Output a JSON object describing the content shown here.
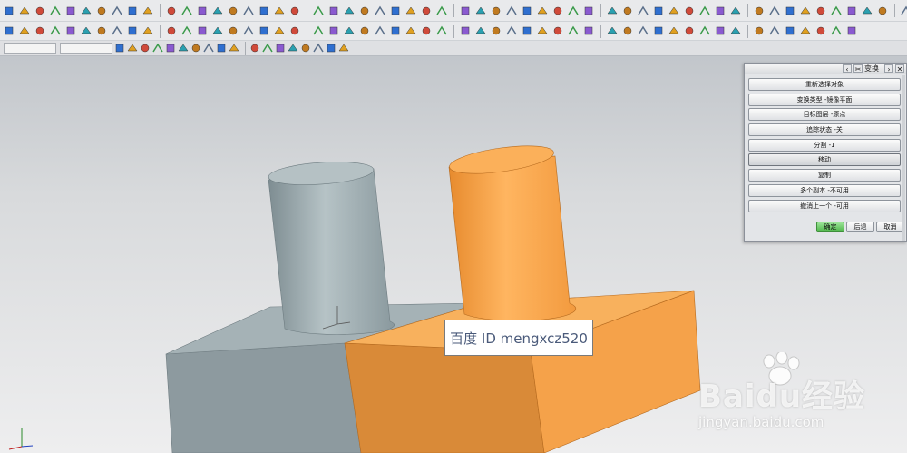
{
  "window": {
    "dialog_title_icon": "scissors-icon",
    "dialog_title": "变换"
  },
  "toolbar": {
    "row1_icons": [
      "grid-icon",
      "edit-icon",
      "copy-icon",
      "tools-icon",
      "vertex-icon",
      "line-icon",
      "curve-icon",
      "wave-icon",
      "spline-icon",
      "pointer-icon",
      "fillet-icon",
      "square-icon",
      "sketch-icon",
      "sphere-icon",
      "cube-icon",
      "block-icon",
      "cylinder-icon",
      "cone-icon",
      "hole-icon",
      "boss-icon",
      "pocket-icon",
      "pad-icon",
      "slot-icon",
      "groove-icon",
      "extrude-icon",
      "revolve-icon",
      "sweep-icon",
      "tube-icon",
      "chamfer-icon",
      "blend-icon",
      "shell-icon",
      "draft-icon",
      "offset-icon",
      "trim-icon",
      "split-icon",
      "sew-icon",
      "patch-icon",
      "unite-icon",
      "subtract-icon",
      "intersect-icon",
      "measure-icon",
      "analyze-icon",
      "view-icon",
      "render-icon",
      "hide-icon",
      "show-icon",
      "layer-icon",
      "color-icon",
      "select-icon",
      "snap-icon",
      "section-icon",
      "zoom-icon",
      "pan-icon",
      "rotate-icon",
      "fit-icon",
      "orient-icon",
      "shade-icon",
      "wire-icon",
      "edge-icon",
      "face-icon",
      "body-icon",
      "feature-icon",
      "sheet-icon",
      "curve2-icon",
      "point-icon",
      "plane-icon",
      "axis-icon",
      "csys-icon",
      "datum-icon",
      "assembly-icon",
      "component-icon",
      "mate-icon",
      "explode-icon",
      "drawing-icon",
      "dimension-icon",
      "note-icon",
      "symbol-icon",
      "table-icon",
      "export-icon",
      "import-icon"
    ],
    "row2_icons": [
      "dot-icon",
      "arrow-icon",
      "cross-icon",
      "joint-icon",
      "square2-icon",
      "hook-icon",
      "bend-icon",
      "line2-icon",
      "arc-icon",
      "zigzag-icon",
      "helix-icon",
      "offset-curve-icon",
      "spline2-icon",
      "project-icon",
      "bridge-icon",
      "cube-blue-icon",
      "block-blue-icon",
      "cylinder-blue-icon",
      "shell-blue-icon",
      "sheet-blue-icon",
      "union-icon",
      "boolean-icon",
      "mirror-icon",
      "pattern-icon",
      "move-icon",
      "datum2-icon",
      "point2-icon",
      "vector-icon",
      "edit2-icon",
      "replace-icon",
      "thicken-icon",
      "flange-icon",
      "rib-icon",
      "emboss-icon",
      "lip-icon",
      "web-icon",
      "snap2-icon",
      "chamfer2-icon",
      "edge2-icon",
      "face2-icon",
      "curve3-icon",
      "blend2-icon",
      "offset2-icon",
      "trim2-icon",
      "extend-icon",
      "split2-icon",
      "pattern2-icon",
      "feature2-icon",
      "group-icon",
      "layer2-icon",
      "measure2-icon",
      "check-icon",
      "info-icon"
    ],
    "row3_icons": [
      "wireframe-icon",
      "edge3-icon",
      "face3-icon",
      "body3-icon",
      "filter-icon",
      "select2-icon",
      "lasso-icon",
      "point3-icon",
      "midpoint-icon",
      "endpoint-icon",
      "center-icon",
      "quad-icon",
      "intersect2-icon",
      "tangent-icon",
      "perp-icon",
      "curve4-icon",
      "plane2-icon",
      "cube3-icon"
    ]
  },
  "scene": {
    "objects": [
      {
        "name": "gray-base-block",
        "color": "#8e9da2"
      },
      {
        "name": "gray-cylinder",
        "color": "#9aa9ad"
      },
      {
        "name": "orange-base-block",
        "color": "#f3a24a"
      },
      {
        "name": "orange-cylinder",
        "color": "#f7a84f"
      }
    ],
    "triad_label": "",
    "watermark": "百度 ID mengxcz520",
    "baidu_logo_text": "Baidu经验",
    "baidu_logo_url_text": "jingyan.baidu.com"
  },
  "dialog": {
    "options": [
      "重新选择对象",
      "变换类型 -镜像平面",
      "目标图层 -原点",
      "追踪状态 -关",
      "分割 -1",
      "移动",
      "复制",
      "多个副本 -不可用",
      "撤消上一个 -可用"
    ],
    "selected_option": "移动",
    "ok_label": "确定",
    "back_label": "后退",
    "cancel_label": "取消"
  },
  "colors": {
    "gray_part": "#93a2a6",
    "orange_part": "#f5a34c",
    "ok_button": "#5cc057"
  }
}
